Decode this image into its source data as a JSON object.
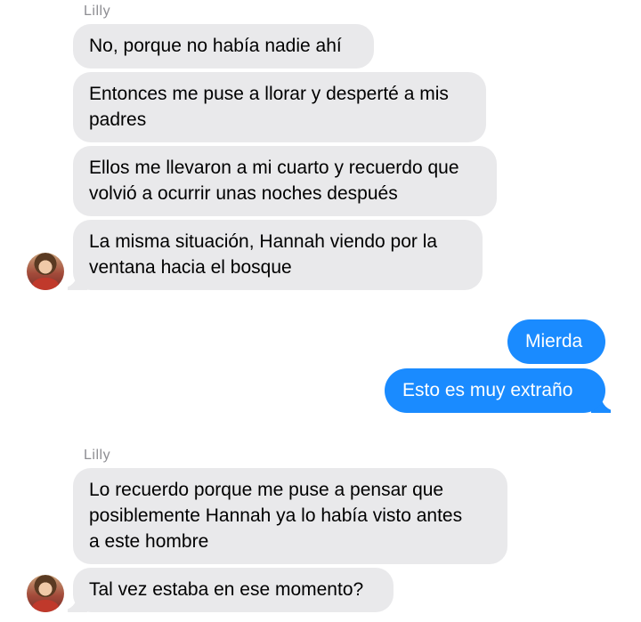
{
  "conversation": {
    "group1": {
      "sender": "Lilly",
      "messages": [
        "No, porque no había nadie ahí",
        "Entonces me puse a llorar y desperté a mis\npadres",
        "Ellos me llevaron a mi cuarto y recuerdo que\nvolvió a ocurrir unas noches después",
        "La misma situación, Hannah viendo por la\nventana hacia el bosque"
      ]
    },
    "outgoing": {
      "messages": [
        "Mierda",
        "Esto es muy extraño"
      ]
    },
    "group2": {
      "sender": "Lilly",
      "messages": [
        "Lo recuerdo porque me puse a pensar que\nposiblemente Hannah ya lo había visto antes\na este hombre",
        "Tal vez estaba en ese momento?"
      ]
    }
  },
  "colors": {
    "incoming_bubble": "#e9e9eb",
    "outgoing_bubble": "#1a8bff",
    "sender_label": "#8e8e93"
  },
  "icons": {
    "avatar": "contact-avatar-photo"
  }
}
